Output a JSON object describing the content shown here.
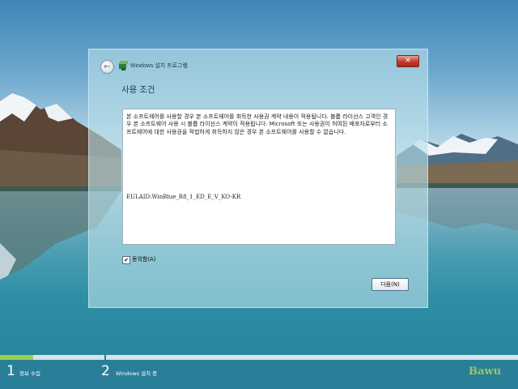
{
  "window": {
    "title": "Windows 설치 프로그램",
    "back_icon": "back-arrow-icon",
    "close_label": "✕"
  },
  "page": {
    "heading": "사용 조건",
    "license_text": "본 소프트웨어를 사용할 경우 본 소프트웨어를 취득한 사용권 계약 내용이 적용됩니다. 볼륨 라이선스 고객인 경우 본 소프트웨어 사용 시 볼륨 라이선스 계약이 적용됩니다. Microsoft 또는 사용권이 허여된 배포자로부터 소프트웨어에 대한 사용권을 적법하게 취득하지 않은 경우 본 소프트웨어를 사용할 수 없습니다.",
    "eula_id": "EULAID:WinBlue_R8_1_ED_E_V_KO-KR",
    "accept_checked": true,
    "accept_label": "동의함(A)",
    "next_label": "다음(N)"
  },
  "progress": {
    "fraction_step1": 0.32,
    "steps": [
      {
        "number": "1",
        "label": "정보 수집"
      },
      {
        "number": "2",
        "label": "Windows 설치 중"
      }
    ]
  },
  "watermark": "Bawu",
  "colors": {
    "progress_fill": "#9bd04b",
    "close_button": "#c0392b",
    "bottom_bar": "#2a7f98"
  }
}
